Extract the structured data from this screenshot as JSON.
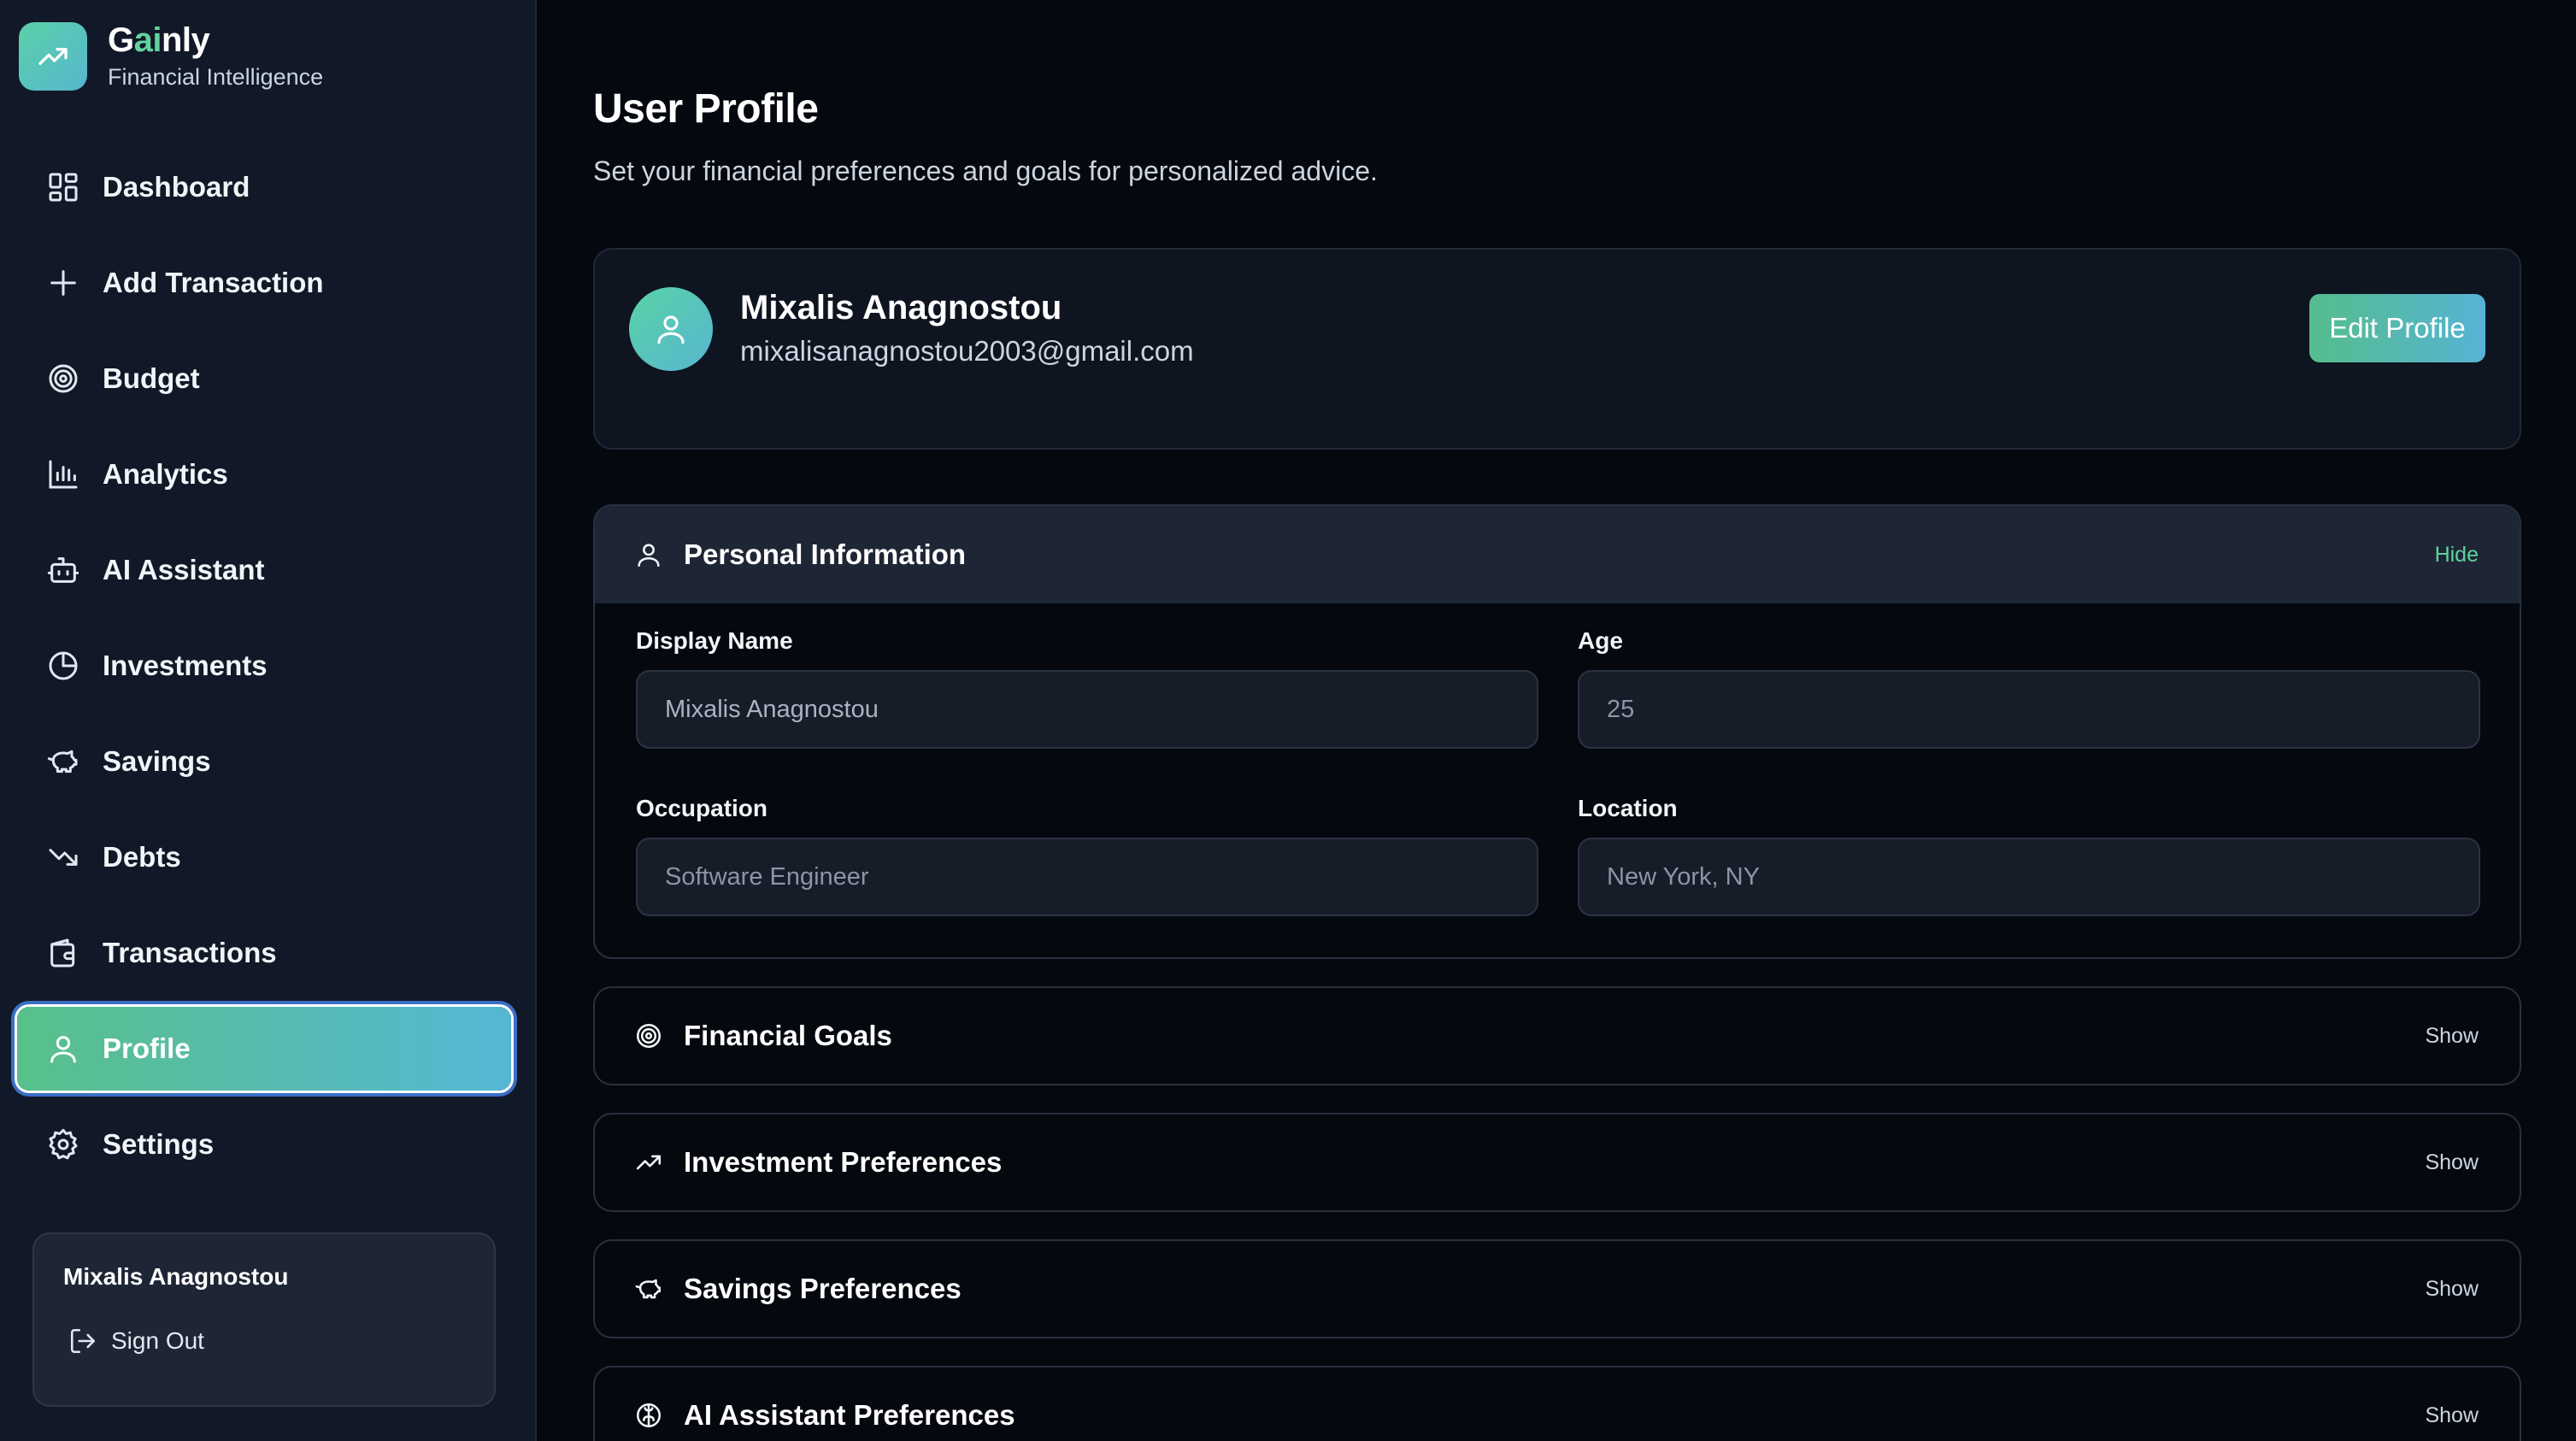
{
  "brand": {
    "name_prefix": "G",
    "name_ai": "ai",
    "name_suffix": "nly",
    "tagline": "Financial Intelligence"
  },
  "nav": {
    "items": [
      {
        "label": "Dashboard",
        "icon": "dashboard-icon"
      },
      {
        "label": "Add Transaction",
        "icon": "plus-icon"
      },
      {
        "label": "Budget",
        "icon": "target-icon"
      },
      {
        "label": "Analytics",
        "icon": "bar-chart-icon"
      },
      {
        "label": "AI Assistant",
        "icon": "bot-icon"
      },
      {
        "label": "Investments",
        "icon": "pie-chart-icon"
      },
      {
        "label": "Savings",
        "icon": "piggy-bank-icon"
      },
      {
        "label": "Debts",
        "icon": "trending-down-icon"
      },
      {
        "label": "Transactions",
        "icon": "wallet-icon"
      },
      {
        "label": "Profile",
        "icon": "user-icon",
        "active": true
      },
      {
        "label": "Settings",
        "icon": "gear-icon"
      }
    ]
  },
  "sidebar_user": {
    "name": "Mixalis Anagnostou",
    "sign_out": "Sign Out"
  },
  "page": {
    "title": "User Profile",
    "subtitle": "Set your financial preferences and goals for personalized advice."
  },
  "profile": {
    "name": "Mixalis Anagnostou",
    "email": "mixalisanagnostou2003@gmail.com",
    "edit_label": "Edit Profile"
  },
  "sections": {
    "personal": {
      "title": "Personal Information",
      "toggle": "Hide",
      "fields": {
        "display_name": {
          "label": "Display Name",
          "value": "Mixalis Anagnostou"
        },
        "age": {
          "label": "Age",
          "placeholder": "25"
        },
        "occupation": {
          "label": "Occupation",
          "placeholder": "Software Engineer"
        },
        "location": {
          "label": "Location",
          "placeholder": "New York, NY"
        }
      }
    },
    "goals": {
      "title": "Financial Goals",
      "toggle": "Show"
    },
    "investment": {
      "title": "Investment Preferences",
      "toggle": "Show"
    },
    "savings": {
      "title": "Savings Preferences",
      "toggle": "Show"
    },
    "ai": {
      "title": "AI Assistant Preferences",
      "toggle": "Show"
    }
  },
  "colors": {
    "accent_green": "#5fd39b",
    "accent_teal": "#56b6d0",
    "background": "#05080f",
    "sidebar": "#111827"
  }
}
